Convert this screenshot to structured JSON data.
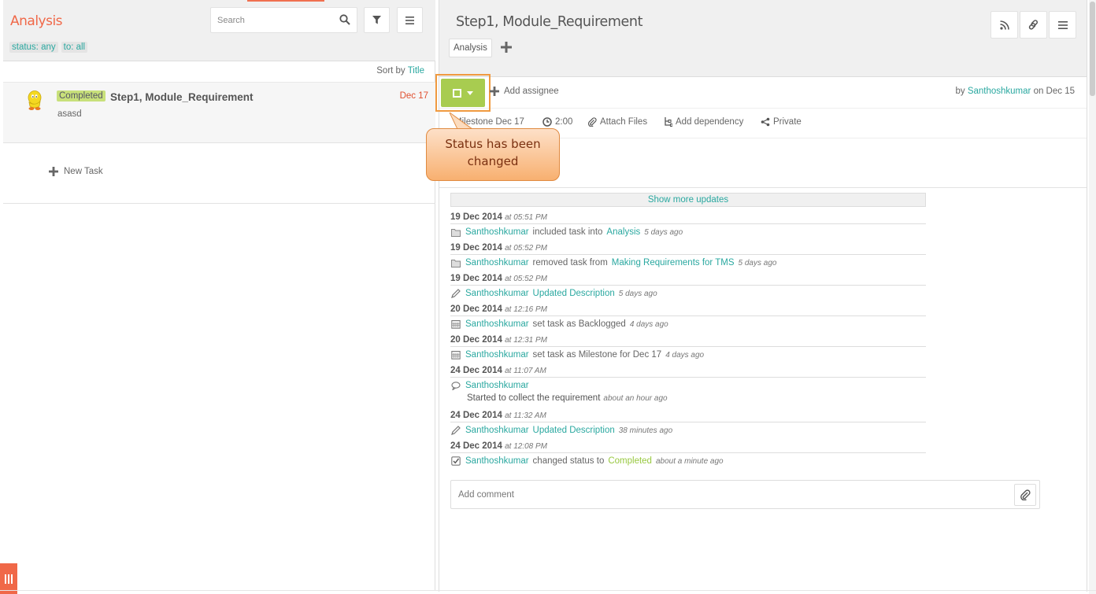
{
  "list": {
    "title": "Analysis",
    "search_placeholder": "Search",
    "filters": [
      "status: any",
      "to: all"
    ],
    "sort_prefix": "Sort by",
    "sort_value": "Title",
    "task": {
      "status": "Completed",
      "title": "Step1, Module_Requirement",
      "date": "Dec 17",
      "description": "asasd"
    },
    "new_task_label": "New Task"
  },
  "detail": {
    "title": "Step1, Module_Requirement",
    "tags": [
      "Analysis"
    ],
    "add_assignee_label": "Add assignee",
    "created_by_prefix": "by",
    "created_by_user": "Santhoshkumar",
    "created_on": "on Dec 15",
    "meta": {
      "milestone": "Milestone Dec 17",
      "time": "2:00",
      "attach": "Attach Files",
      "dependency": "Add dependency",
      "privacy": "Private"
    },
    "callout": "Status has been changed",
    "show_more_label": "Show more updates",
    "history": [
      {
        "date": "19 Dec 2014",
        "time": "at 05:51 PM",
        "icon": "folder-icon",
        "user": "Santhoshkumar",
        "action": "included task into",
        "target": "Analysis",
        "ago": "5 days ago"
      },
      {
        "date": "19 Dec 2014",
        "time": "at 05:52 PM",
        "icon": "folder-icon",
        "user": "Santhoshkumar",
        "action": "removed task from",
        "target": "Making Requirements for TMS",
        "ago": "5 days ago"
      },
      {
        "date": "19 Dec 2014",
        "time": "at 05:52 PM",
        "icon": "pencil-icon",
        "user": "Santhoshkumar",
        "action": "",
        "target": "Updated Description",
        "ago": "5 days ago"
      },
      {
        "date": "20 Dec 2014",
        "time": "at 12:16 PM",
        "icon": "calendar-icon",
        "user": "Santhoshkumar",
        "action": "set task as Backlogged",
        "target": "",
        "ago": "4 days ago"
      },
      {
        "date": "20 Dec 2014",
        "time": "at 12:31 PM",
        "icon": "calendar-icon",
        "user": "Santhoshkumar",
        "action": "set task as Milestone for Dec 17",
        "target": "",
        "ago": "4 days ago"
      },
      {
        "date": "24 Dec 2014",
        "time": "at 11:07 AM",
        "icon": "comment-icon",
        "user": "Santhoshkumar",
        "action": "",
        "target": "",
        "ago": "",
        "comment": "Started to collect the requirement",
        "comment_ago": "about an hour ago"
      },
      {
        "date": "24 Dec 2014",
        "time": "at 11:32 AM",
        "icon": "pencil-icon",
        "user": "Santhoshkumar",
        "action": "",
        "target": "Updated Description",
        "ago": "38 minutes ago"
      },
      {
        "date": "24 Dec 2014",
        "time": "at 12:08 PM",
        "icon": "checkbox-icon",
        "user": "Santhoshkumar",
        "action": "changed status to",
        "status": "Completed",
        "target": "",
        "ago": "about a minute ago"
      }
    ],
    "comment_placeholder": "Add comment"
  },
  "colors": {
    "accent": "#f06848",
    "link": "#2aa8a0",
    "completed": "#a8cc50",
    "callout_border": "#f09a40"
  }
}
